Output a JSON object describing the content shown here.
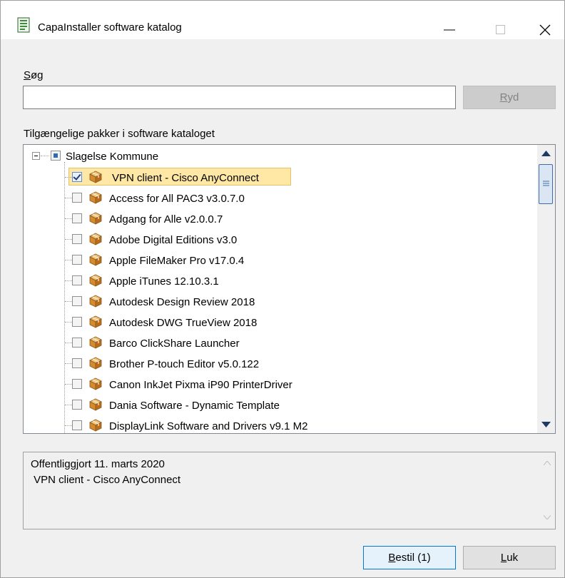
{
  "window": {
    "title": "CapaInstaller software katalog"
  },
  "search": {
    "label_first": "S",
    "label_rest": "øg",
    "value": "",
    "placeholder": "",
    "clear_button_first": "R",
    "clear_button_rest": "yd",
    "clear_button_enabled": false
  },
  "available": {
    "label": "Tilgængelige pakker i software kataloget"
  },
  "tree": {
    "root_label": "Slagelse Kommune",
    "root_state": "mixed",
    "items": [
      {
        "label": "VPN client - Cisco AnyConnect",
        "checked": true,
        "selected": true
      },
      {
        "label": "Access for All PAC3 v3.0.7.0",
        "checked": false,
        "selected": false
      },
      {
        "label": "Adgang for Alle v2.0.0.7",
        "checked": false,
        "selected": false
      },
      {
        "label": "Adobe Digital Editions v3.0",
        "checked": false,
        "selected": false
      },
      {
        "label": "Apple FileMaker Pro v17.0.4",
        "checked": false,
        "selected": false
      },
      {
        "label": "Apple iTunes 12.10.3.1",
        "checked": false,
        "selected": false
      },
      {
        "label": "Autodesk Design Review 2018",
        "checked": false,
        "selected": false
      },
      {
        "label": "Autodesk DWG TrueView 2018",
        "checked": false,
        "selected": false
      },
      {
        "label": "Barco ClickShare Launcher",
        "checked": false,
        "selected": false
      },
      {
        "label": "Brother P-touch Editor v5.0.122",
        "checked": false,
        "selected": false
      },
      {
        "label": "Canon InkJet Pixma iP90 PrinterDriver",
        "checked": false,
        "selected": false
      },
      {
        "label": "Dania Software - Dynamic Template",
        "checked": false,
        "selected": false
      },
      {
        "label": "DisplayLink Software and Drivers v9.1 M2",
        "checked": false,
        "selected": false
      }
    ]
  },
  "details": {
    "text": "Offentliggjort 11. marts 2020\n VPN client - Cisco AnyConnect"
  },
  "buttons": {
    "order_first": "B",
    "order_rest": "estil (1)",
    "close_first": "L",
    "close_rest": "uk"
  },
  "colors": {
    "accent": "#0078d7",
    "selection": "#ffe8a6",
    "checkbox_mark": "#1e3f7a"
  }
}
